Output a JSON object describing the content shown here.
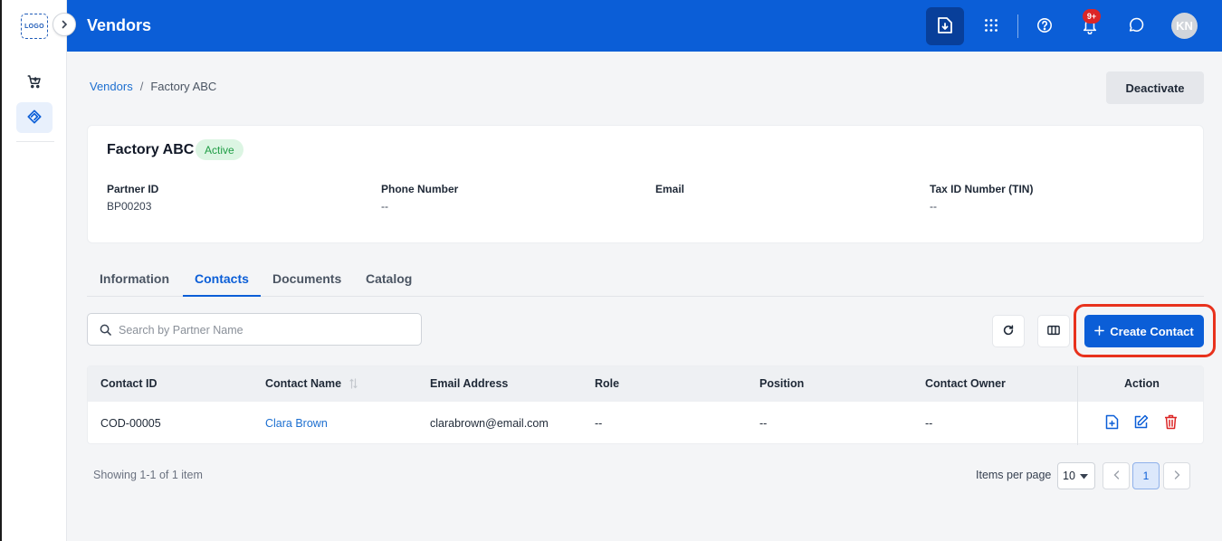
{
  "sidebar": {
    "logo_text": "LOGO",
    "items": [
      {
        "name": "cart-icon",
        "active": false
      },
      {
        "name": "vendor-icon",
        "active": true
      }
    ]
  },
  "header": {
    "title": "Vendors",
    "notification_badge": "9+",
    "avatar_initials": "KN",
    "color": "#0b5ed7"
  },
  "breadcrumb": {
    "parent": "Vendors",
    "separator": "/",
    "current": "Factory ABC"
  },
  "actions": {
    "deactivate_label": "Deactivate"
  },
  "vendor": {
    "name": "Factory ABC",
    "status": "Active",
    "fields": [
      {
        "label": "Partner ID",
        "value": "BP00203"
      },
      {
        "label": "Phone Number",
        "value": "--"
      },
      {
        "label": "Email",
        "value": ""
      },
      {
        "label": "Tax ID Number (TIN)",
        "value": "--"
      }
    ]
  },
  "tabs": [
    {
      "label": "Information",
      "active": false
    },
    {
      "label": "Contacts",
      "active": true
    },
    {
      "label": "Documents",
      "active": false
    },
    {
      "label": "Catalog",
      "active": false
    }
  ],
  "toolbar": {
    "search_placeholder": "Search by Partner Name",
    "search_value": "",
    "create_label": "Create Contact"
  },
  "table": {
    "columns": [
      "Contact ID",
      "Contact Name",
      "Email Address",
      "Role",
      "Position",
      "Contact Owner",
      "Action"
    ],
    "rows": [
      {
        "contact_id": "COD-00005",
        "contact_name": "Clara Brown",
        "email": "clarabrown@email.com",
        "role": "--",
        "position": "--",
        "owner": "--"
      }
    ]
  },
  "pagination": {
    "showing": "Showing 1-1 of 1 item",
    "items_per_page_label": "Items per page",
    "items_per_page": "10",
    "current_page": "1",
    "prev_icon": "chevron-left-icon",
    "next_icon": "chevron-right-icon"
  }
}
